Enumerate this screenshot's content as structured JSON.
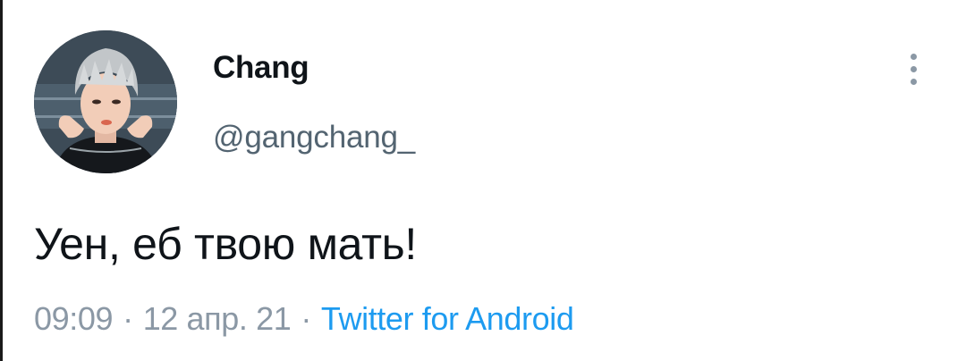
{
  "tweet": {
    "author": {
      "name": "Chang",
      "handle": "@gangchang_"
    },
    "text": "Уен, еб твою мать!",
    "time": "09:09",
    "date": "12 апр. 21",
    "separator": "·",
    "source": "Twitter for Android"
  },
  "colors": {
    "name": "#0f1419",
    "handle": "#536471",
    "meta": "#8b98a5",
    "link": "#1d9bf0"
  },
  "icons": {
    "more": "more-vertical-icon"
  }
}
